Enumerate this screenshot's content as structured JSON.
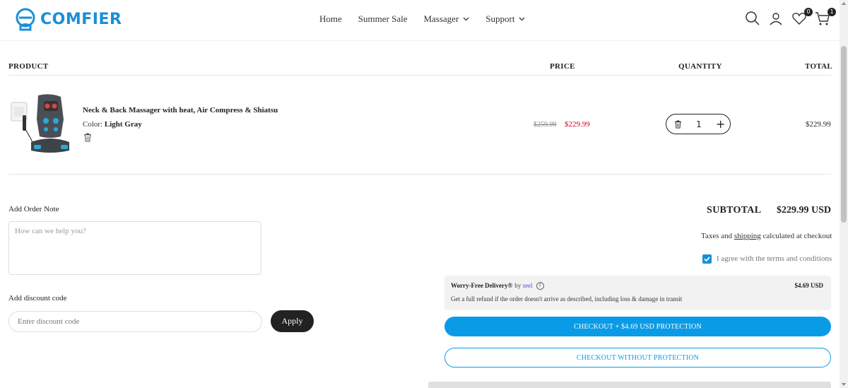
{
  "brand": {
    "name": "COMFIER",
    "color": "#1a8fd6"
  },
  "nav": {
    "items": [
      {
        "label": "Home",
        "has_dropdown": false
      },
      {
        "label": "Summer Sale",
        "has_dropdown": false
      },
      {
        "label": "Massager",
        "has_dropdown": true
      },
      {
        "label": "Support",
        "has_dropdown": true
      }
    ]
  },
  "header_icons": {
    "search": "search-icon",
    "account": "user-icon",
    "wishlist": {
      "icon": "heart-icon",
      "count": "0"
    },
    "cart": {
      "icon": "cart-icon",
      "count": "1"
    }
  },
  "table": {
    "headers": {
      "product": "PRODUCT",
      "price": "PRICE",
      "quantity": "QUANTITY",
      "total": "TOTAL"
    }
  },
  "cart_item": {
    "name": "Neck & Back Massager with heat, Air Compress & Shiatsu",
    "color_label": "Color:",
    "color_value": "Light Gray",
    "price_original": "$259.99",
    "price_sale": "$229.99",
    "quantity": "1",
    "line_total": "$229.99"
  },
  "order_note": {
    "label": "Add Order Note",
    "placeholder": "How can we help you?"
  },
  "discount": {
    "label": "Add discount code",
    "placeholder": "Enter discount code",
    "apply_label": "Apply"
  },
  "summary": {
    "subtotal_label": "SUBTOTAL",
    "subtotal_value": "$229.99 USD",
    "taxes_prefix": "Taxes and ",
    "taxes_link": "shipping",
    "taxes_suffix": " calculated at checkout",
    "agree_text": "I agree with the terms and conditions",
    "agree_checked": true
  },
  "protection": {
    "title": "Worry-Free Delivery®",
    "by": "by",
    "brand": "seel",
    "price": "$4.69 USD",
    "description": "Get a full refund if the order doesn't arrive as described, including loss & damage in transit"
  },
  "buttons": {
    "checkout_protect": "CHECKOUT + $4.69 USD PROTECTION",
    "checkout_plain": "CHECKOUT WITHOUT PROTECTION"
  },
  "colors": {
    "accent": "#0a9be6",
    "sale": "#d0011b",
    "dark": "#222222"
  }
}
